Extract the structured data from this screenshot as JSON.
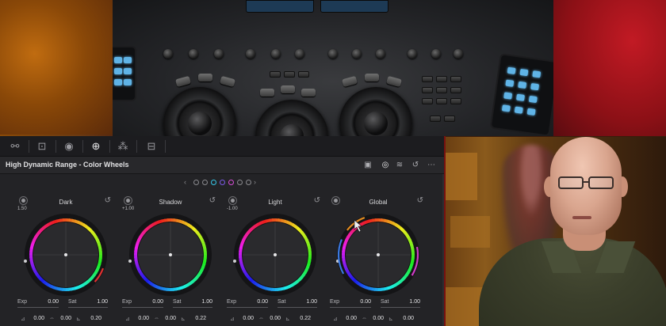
{
  "panel": {
    "title": "High Dynamic Range - Color Wheels"
  },
  "toolbar_icons": [
    "curves-icon",
    "sizing-icon",
    "node-icon",
    "hdr-zone-icon",
    "blur-icon",
    "keyframes-icon"
  ],
  "header_icons": [
    "picture-in-picture-icon",
    "zone-target-icon",
    "waveform-icon",
    "reset-icon",
    "more-icon"
  ],
  "page_dots": [
    "#8a8a8e",
    "#8a8a8e",
    "#36c7e8",
    "#7b5be8",
    "#d84fd8",
    "#8a8a8e",
    "#8a8a8e"
  ],
  "wheels": [
    {
      "name": "Dark",
      "zone_value": "1.50",
      "exp": "0.00",
      "sat": "1.00",
      "x": "0.00",
      "y": "0.00",
      "z": "0.20",
      "accent": "#e03030"
    },
    {
      "name": "Shadow",
      "zone_value": "+1.00",
      "exp": "0.00",
      "sat": "1.00",
      "x": "0.00",
      "y": "0.00",
      "z": "0.22",
      "accent": ""
    },
    {
      "name": "Light",
      "zone_value": "-1.00",
      "exp": "0.00",
      "sat": "1.00",
      "x": "0.00",
      "y": "0.00",
      "z": "0.22",
      "accent": ""
    },
    {
      "name": "Global",
      "zone_value": "",
      "exp": "0.00",
      "sat": "1.00",
      "x": "0.00",
      "y": "0.00",
      "z": "0.00",
      "accent": "#d03cc8"
    }
  ],
  "labels": {
    "exp": "Exp",
    "sat": "Sat"
  },
  "colors": {
    "panel_bg": "#232326",
    "header_bg": "#28282b"
  }
}
